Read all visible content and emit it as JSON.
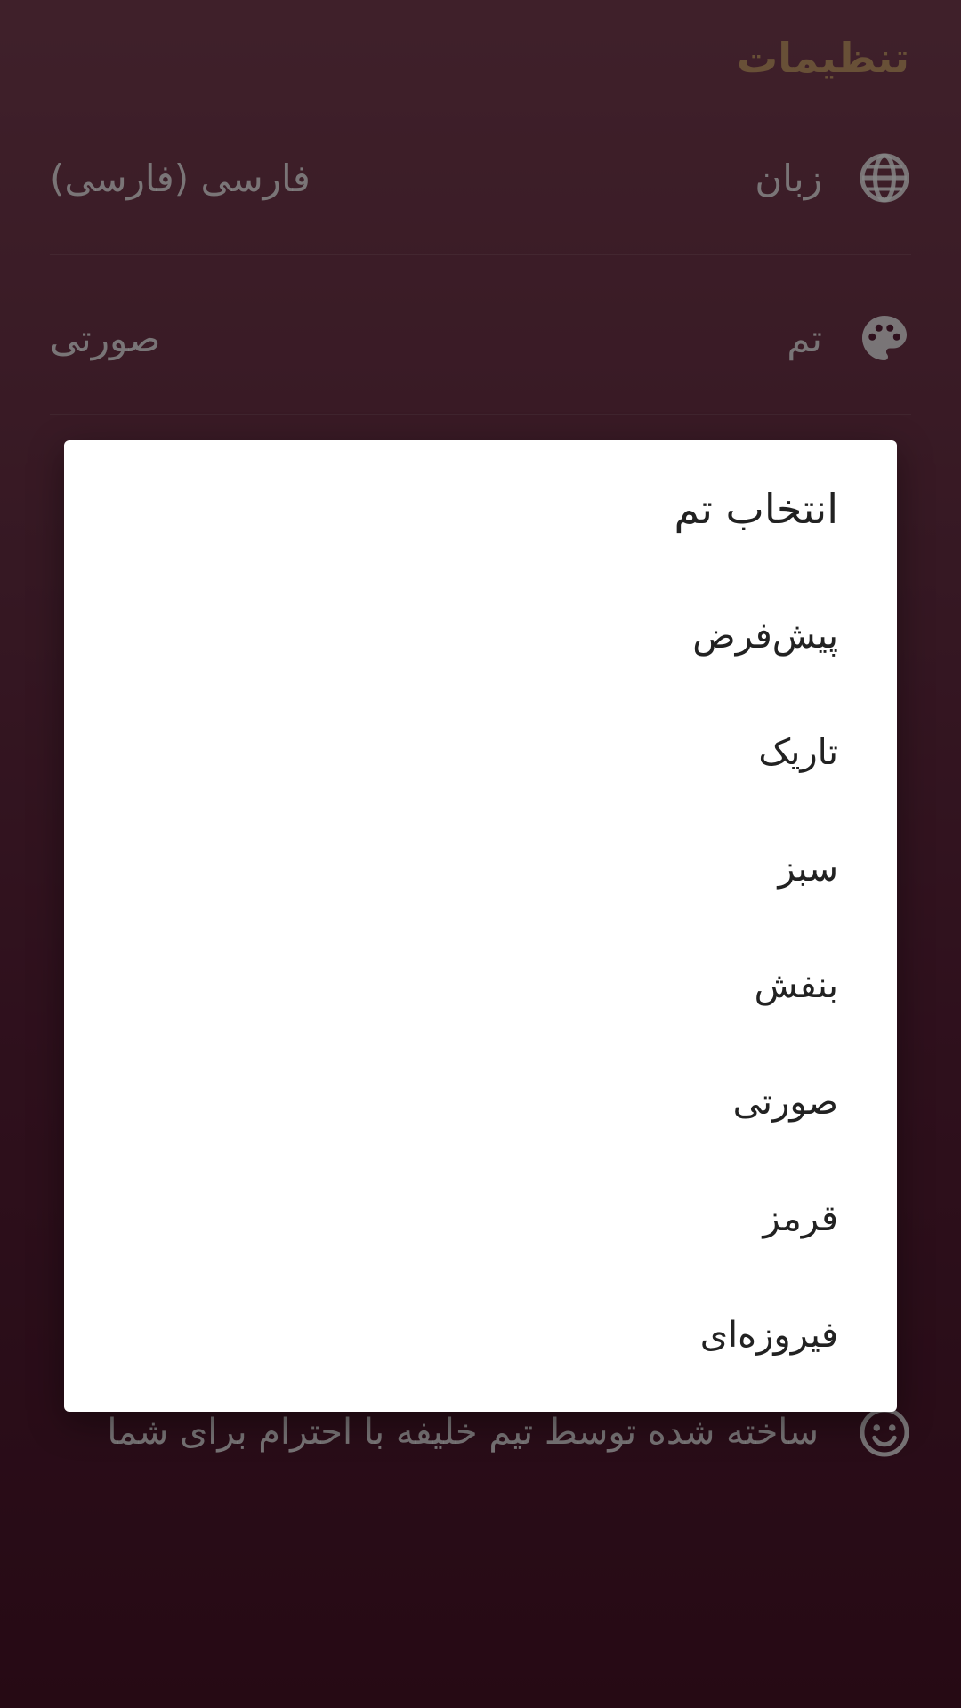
{
  "settings": {
    "title": "تنظیمات",
    "rows": [
      {
        "label": "زبان",
        "value": "فارسی (فارسی)",
        "icon": "globe-icon"
      },
      {
        "label": "تم",
        "value": "صورتی",
        "icon": "palette-icon"
      }
    ],
    "footer": {
      "text": "ساخته شده توسط تیم خلیفه با احترام برای شما",
      "icon": "smiley-icon"
    }
  },
  "dialog": {
    "title": "انتخاب تم",
    "options": [
      {
        "label": "پیش‌فرض"
      },
      {
        "label": "تاریک"
      },
      {
        "label": "سبز"
      },
      {
        "label": "بنفش"
      },
      {
        "label": "صورتی"
      },
      {
        "label": "قرمز"
      },
      {
        "label": "فیروزه‌ای"
      }
    ]
  },
  "colors": {
    "title_accent": "#c79a6a",
    "background_top": "#7a3f52",
    "background_bottom": "#4a1428",
    "dialog_bg": "#ffffff",
    "dialog_text": "#222222"
  }
}
